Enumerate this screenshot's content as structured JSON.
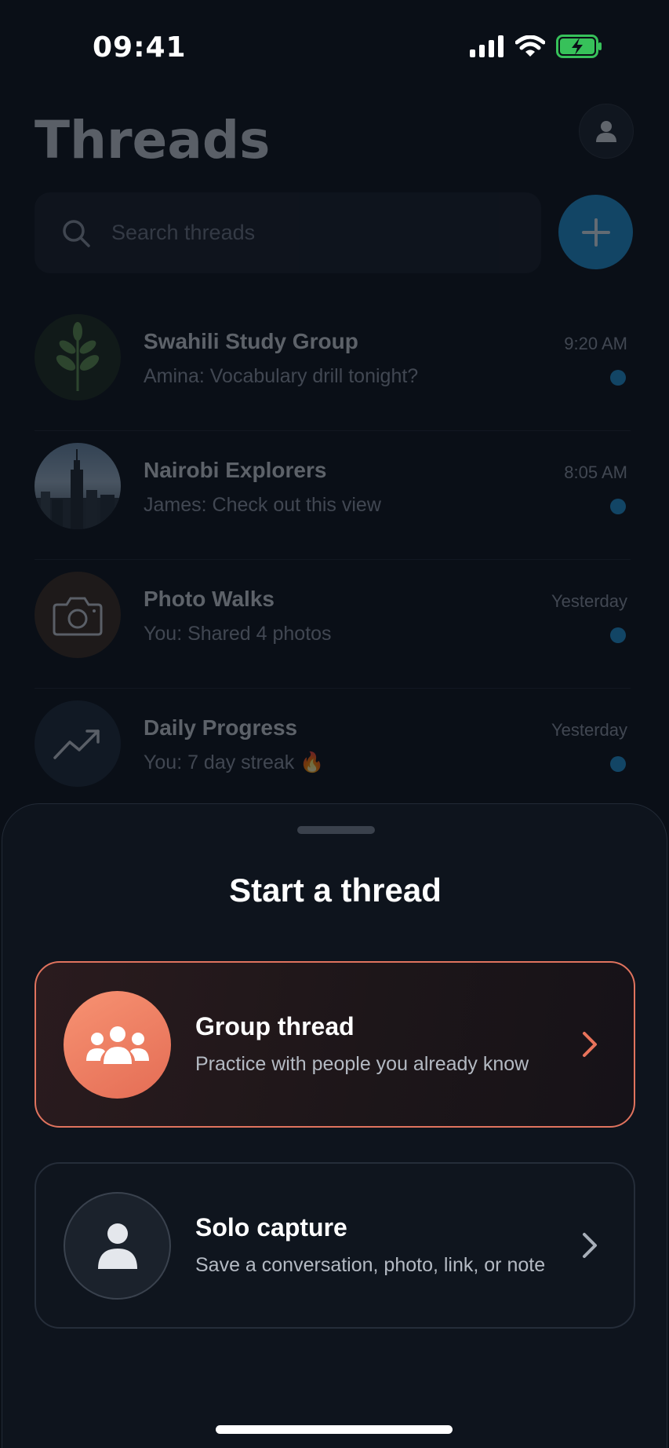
{
  "status_bar": {
    "time": "09:41"
  },
  "header": {
    "title": "Threads"
  },
  "search": {
    "placeholder": "Search threads"
  },
  "threads": [
    {
      "name": "Swahili Study Group",
      "preview": "Amina: Vocabulary drill tonight?",
      "time": "9:20 AM",
      "unread": true,
      "avatar": "plant-icon"
    },
    {
      "name": "Nairobi Explorers",
      "preview": "James: Check out this view",
      "time": "8:05 AM",
      "unread": true,
      "avatar": "city-skyline-photo"
    },
    {
      "name": "Photo Walks",
      "preview": "You: Shared 4 photos",
      "time": "Yesterday",
      "unread": true,
      "avatar": "camera-icon"
    },
    {
      "name": "Daily Progress",
      "preview": "You: 7 day streak 🔥",
      "time": "Yesterday",
      "unread": true,
      "avatar": "trending-up-icon"
    }
  ],
  "sheet": {
    "title": "Start a thread",
    "options": [
      {
        "title": "Group thread",
        "description": "Practice with people you already know",
        "icon": "group-icon",
        "selected": true
      },
      {
        "title": "Solo capture",
        "description": "Save a conversation, photo, link, or note",
        "icon": "person-icon",
        "selected": false
      }
    ]
  },
  "colors": {
    "accent_blue": "#1e8fd2",
    "accent_coral": "#e8735b",
    "background": "#0a0f17"
  }
}
